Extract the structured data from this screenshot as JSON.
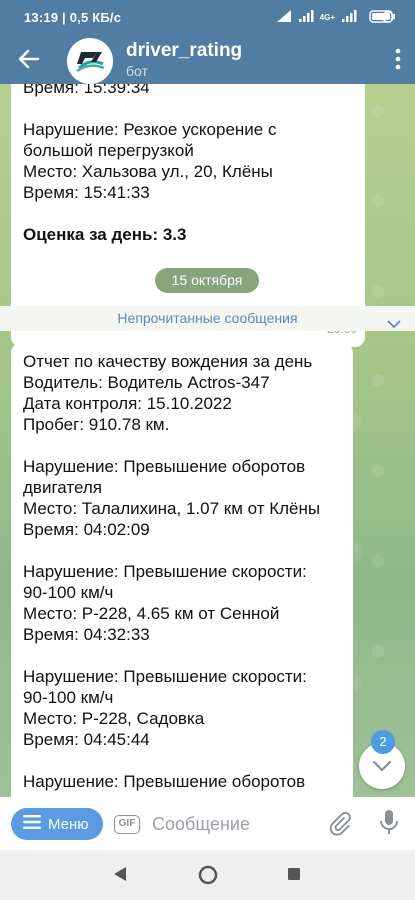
{
  "statusbar": {
    "time": "13:19",
    "net_speed": "0,5 КБ/с",
    "battery_icon": "battery-icon",
    "signal_icon": "signal-icon",
    "wifi_icon": "wifi-icon",
    "alarm_icon": "alarm-icon",
    "network_label": "4G+"
  },
  "header": {
    "title": "driver_rating",
    "subtitle": "бот",
    "back_icon": "arrow-left-icon",
    "more_icon": "more-vertical-icon",
    "bg_color": "#517da2"
  },
  "messages": {
    "first": {
      "lines": [
        "Время: 15:39:34",
        "",
        "Нарушение: Резкое ускорение с",
        "большой перегрузкой",
        "Место: Хальзова ул., 20, Клёны",
        "Время: 15:41:33",
        ""
      ],
      "rating": "Оценка за день: 3.3",
      "time": "20:00"
    },
    "date_separator": "15 октября",
    "unread_label": "Непрочитанные сообщения",
    "second": {
      "lines": [
        "Отчет по качеству вождения за день",
        "Водитель: Водитель Actros-347",
        "Дата контроля: 15.10.2022",
        "Пробег: 910.78 км.",
        "",
        "Нарушение: Превышение оборотов",
        "двигателя",
        "Место: Талалихина, 1.07 км от Клёны",
        "Время: 04:02:09",
        "",
        "Нарушение: Превышение скорости:",
        "90-100 км/ч",
        "Место: Р-228, 4.65 км от Сенной",
        "Время: 04:32:33",
        "",
        "Нарушение: Превышение скорости:",
        "90-100 км/ч",
        "Место: Р-228, Садовка",
        "Время: 04:45:44",
        "",
        "Нарушение: Превышение оборотов"
      ]
    }
  },
  "scroll": {
    "unread_count": "2"
  },
  "input": {
    "menu_label": "Меню",
    "gif_label": "GIF",
    "placeholder": "Сообщение",
    "accent_color": "#5b9be2"
  },
  "navbar": {
    "back_icon": "nav-back-icon",
    "home_icon": "nav-home-icon",
    "recents_icon": "nav-recents-icon"
  }
}
